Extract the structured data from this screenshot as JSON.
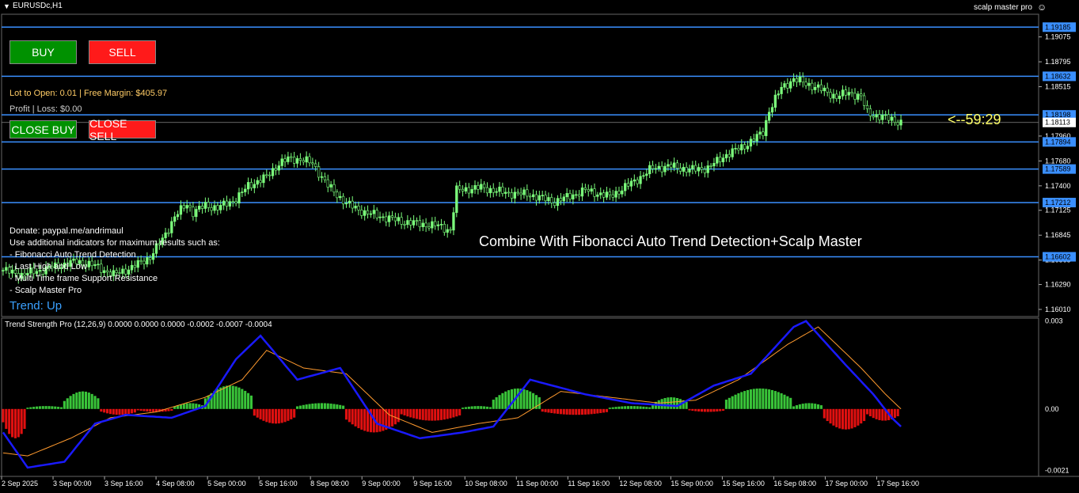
{
  "window": {
    "symbol": "EURUSDc,H1",
    "ea_name": "scalp master pro"
  },
  "buttons": {
    "buy": "BUY",
    "sell": "SELL",
    "close_buy": "CLOSE BUY",
    "close_sell": "CLOSE SELL"
  },
  "info": {
    "lot": "Lot to Open: 0.01 | Free Margin: $405.97",
    "profit_loss": "Profit | Loss: $0.00",
    "donate_lines": [
      "Donate: paypal.me/andrimaul",
      "Use additional indicators for maximum results such as:",
      "- Fibonacci Auto Trend Detection",
      "- Last High and Low",
      "- Multi Time frame Support Resistance",
      "- Scalp Master Pro"
    ],
    "trend": "Trend: Up",
    "combine": "Combine With Fibonacci Auto Trend Detection+Scalp Master",
    "timer": "<--59:29"
  },
  "colors": {
    "bull": "#7cff7c",
    "level": "#3a8fff",
    "hist_pos": "#39c439",
    "hist_neg": "#e01010",
    "signal_blue": "#1a1aff",
    "signal_orange": "#ff9a2e"
  },
  "chart_data": {
    "type": "candlestick",
    "price_axis_ticks": [
      "1.19075",
      "1.18795",
      "1.18515",
      "1.17960",
      "1.17680",
      "1.17400",
      "1.17125",
      "1.16845",
      "1.16565",
      "1.16290",
      "1.16010"
    ],
    "level_lines": [
      {
        "price": 1.19185,
        "label": "1.19185"
      },
      {
        "price": 1.18632,
        "label": "1.18632"
      },
      {
        "price": 1.18198,
        "label": "1.18198"
      },
      {
        "price": 1.17894,
        "label": "1.17894"
      },
      {
        "price": 1.17589,
        "label": "1.17589"
      },
      {
        "price": 1.17212,
        "label": "1.17212"
      },
      {
        "price": 1.16602,
        "label": "1.16602"
      }
    ],
    "current_price": {
      "price": 1.18113,
      "label": "1.18113"
    },
    "price_range": [
      1.1593,
      1.1933
    ],
    "close_path": [
      [
        0,
        1.1645
      ],
      [
        6,
        1.164
      ],
      [
        12,
        1.1645
      ],
      [
        18,
        1.165
      ],
      [
        24,
        1.1655
      ],
      [
        30,
        1.165
      ],
      [
        36,
        1.164
      ],
      [
        42,
        1.1648
      ],
      [
        48,
        1.166
      ],
      [
        52,
        1.168
      ],
      [
        56,
        1.1705
      ],
      [
        60,
        1.172
      ],
      [
        62,
        1.171
      ],
      [
        66,
        1.1718
      ],
      [
        70,
        1.1715
      ],
      [
        76,
        1.1725
      ],
      [
        80,
        1.174
      ],
      [
        86,
        1.175
      ],
      [
        90,
        1.1765
      ],
      [
        93,
        1.177
      ],
      [
        97,
        1.177
      ],
      [
        101,
        1.1765
      ],
      [
        106,
        1.174
      ],
      [
        112,
        1.172
      ],
      [
        118,
        1.171
      ],
      [
        124,
        1.1705
      ],
      [
        130,
        1.17
      ],
      [
        136,
        1.1697
      ],
      [
        142,
        1.1695
      ],
      [
        146,
        1.169
      ],
      [
        148,
        1.1735
      ],
      [
        156,
        1.1738
      ],
      [
        164,
        1.1732
      ],
      [
        172,
        1.173
      ],
      [
        180,
        1.1722
      ],
      [
        190,
        1.1735
      ],
      [
        198,
        1.1728
      ],
      [
        206,
        1.1745
      ],
      [
        212,
        1.176
      ],
      [
        218,
        1.1762
      ],
      [
        224,
        1.1758
      ],
      [
        230,
        1.176
      ],
      [
        236,
        1.1775
      ],
      [
        242,
        1.1785
      ],
      [
        248,
        1.18
      ],
      [
        250,
        1.1825
      ],
      [
        254,
        1.185
      ],
      [
        258,
        1.186
      ],
      [
        262,
        1.1855
      ],
      [
        266,
        1.185
      ],
      [
        272,
        1.184
      ],
      [
        276,
        1.1845
      ],
      [
        280,
        1.184
      ],
      [
        282,
        1.1822
      ],
      [
        286,
        1.1818
      ],
      [
        290,
        1.1815
      ],
      [
        293,
        1.1811
      ]
    ],
    "indicator": {
      "title": "Trend Strength Pro (12,26,9) 0.0000 0.0000 0.0000 -0.0002 -0.0007 -0.0004",
      "axis_ticks": [
        "0.003",
        "0.00",
        "-0.0021"
      ],
      "range": [
        -0.0023,
        0.0031
      ],
      "zero": 0,
      "fast_line": [
        [
          0,
          -0.0008
        ],
        [
          8,
          -0.002
        ],
        [
          20,
          -0.0018
        ],
        [
          30,
          -0.0005
        ],
        [
          40,
          -0.0002
        ],
        [
          55,
          -0.0003
        ],
        [
          66,
          0.0001
        ],
        [
          76,
          0.0017
        ],
        [
          84,
          0.0025
        ],
        [
          96,
          0.001
        ],
        [
          110,
          0.0014
        ],
        [
          122,
          -0.0005
        ],
        [
          136,
          -0.001
        ],
        [
          150,
          -0.0008
        ],
        [
          160,
          -0.0006
        ],
        [
          172,
          0.001
        ],
        [
          190,
          0.0005
        ],
        [
          205,
          0.0002
        ],
        [
          220,
          0.0001
        ],
        [
          232,
          0.0008
        ],
        [
          244,
          0.0012
        ],
        [
          258,
          0.0028
        ],
        [
          262,
          0.003
        ],
        [
          275,
          0.0015
        ],
        [
          284,
          0.0005
        ],
        [
          290,
          -0.0003
        ],
        [
          293,
          -0.0006
        ]
      ],
      "slow_line": [
        [
          0,
          -0.0015
        ],
        [
          8,
          -0.0016
        ],
        [
          22,
          -0.001
        ],
        [
          35,
          -0.0003
        ],
        [
          50,
          -0.0001
        ],
        [
          66,
          0.0004
        ],
        [
          78,
          0.001
        ],
        [
          86,
          0.002
        ],
        [
          98,
          0.0014
        ],
        [
          112,
          0.0012
        ],
        [
          126,
          -0.0002
        ],
        [
          140,
          -0.0008
        ],
        [
          155,
          -0.0005
        ],
        [
          168,
          -0.0003
        ],
        [
          182,
          0.0006
        ],
        [
          198,
          0.0004
        ],
        [
          214,
          0.0002
        ],
        [
          226,
          0.0003
        ],
        [
          240,
          0.001
        ],
        [
          256,
          0.0022
        ],
        [
          266,
          0.0028
        ],
        [
          280,
          0.0014
        ],
        [
          288,
          0.0005
        ],
        [
          293,
          0.0
        ]
      ],
      "histogram_segments": [
        [
          0,
          8,
          -0.001
        ],
        [
          8,
          20,
          0.0001
        ],
        [
          20,
          32,
          0.0006
        ],
        [
          32,
          44,
          -0.0002
        ],
        [
          44,
          56,
          -0.0001
        ],
        [
          56,
          66,
          0.0002
        ],
        [
          66,
          82,
          0.0008
        ],
        [
          82,
          96,
          -0.0005
        ],
        [
          96,
          112,
          0.0002
        ],
        [
          112,
          130,
          -0.0008
        ],
        [
          130,
          150,
          -0.0004
        ],
        [
          150,
          160,
          0.0001
        ],
        [
          160,
          176,
          0.0007
        ],
        [
          176,
          198,
          -0.0002
        ],
        [
          198,
          212,
          0.0001
        ],
        [
          212,
          224,
          0.0004
        ],
        [
          224,
          236,
          -0.0001
        ],
        [
          236,
          258,
          0.0007
        ],
        [
          258,
          268,
          0.0002
        ],
        [
          268,
          282,
          -0.0007
        ],
        [
          282,
          293,
          -0.0004
        ]
      ]
    },
    "time_axis_ticks": [
      "2 Sep 2025",
      "3 Sep 00:00",
      "3 Sep 16:00",
      "4 Sep 08:00",
      "5 Sep 00:00",
      "5 Sep 16:00",
      "8 Sep 08:00",
      "9 Sep 00:00",
      "9 Sep 16:00",
      "10 Sep 08:00",
      "11 Sep 00:00",
      "11 Sep 16:00",
      "12 Sep 08:00",
      "15 Sep 00:00",
      "15 Sep 16:00",
      "16 Sep 08:00",
      "17 Sep 00:00",
      "17 Sep 16:00"
    ]
  }
}
